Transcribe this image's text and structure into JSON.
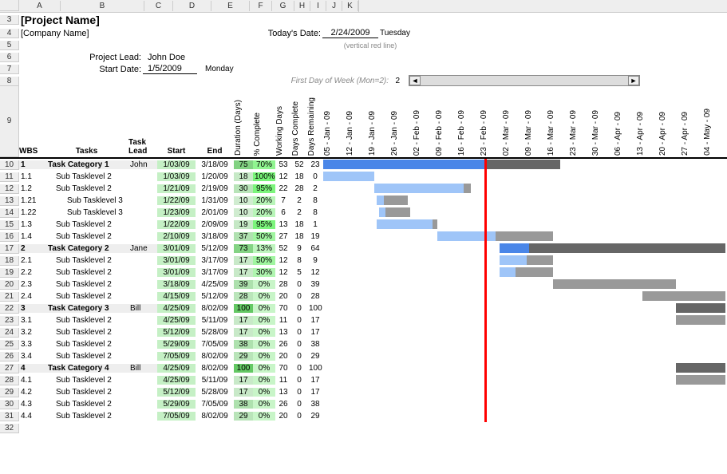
{
  "col_letters": [
    "A",
    "B",
    "C",
    "D",
    "E",
    "F",
    "G",
    "H",
    "I",
    "J",
    "K"
  ],
  "col_letter_widths": [
    52,
    105,
    36,
    48,
    48,
    28,
    28,
    20,
    20,
    20,
    20
  ],
  "header": {
    "project_name": "[Project Name]",
    "company_name": "[Company Name]",
    "todays_date_label": "Today's Date:",
    "todays_date": "2/24/2009",
    "todays_day": "Tuesday",
    "vertical_note": "(vertical red line)",
    "project_lead_label": "Project Lead:",
    "project_lead": "John Doe",
    "start_date_label": "Start Date:",
    "start_date": "1/5/2009",
    "start_day": "Monday",
    "first_day_label": "First Day of Week (Mon=2):",
    "first_day_value": "2"
  },
  "columns": {
    "wbs": "WBS",
    "tasks": "Tasks",
    "lead": "Task Lead",
    "start": "Start",
    "end": "End",
    "duration": "Duration (Days)",
    "pct": "% Complete",
    "wd": "Working Days",
    "dc": "Days Complete",
    "dr": "Days Remaining"
  },
  "timeline": [
    "05 - Jan - 09",
    "12 - Jan - 09",
    "19 - Jan - 09",
    "26 - Jan - 09",
    "02 - Feb - 09",
    "09 - Feb - 09",
    "16 - Feb - 09",
    "23 - Feb - 09",
    "02 - Mar - 09",
    "09 - Mar - 09",
    "16 - Mar - 09",
    "23 - Mar - 09",
    "30 - Mar - 09",
    "06 - Apr - 09",
    "13 - Apr - 09",
    "20 - Apr - 09",
    "27 - Apr - 09",
    "04 - May - 09"
  ],
  "today_index": 7.2,
  "row_start": 10,
  "rows": [
    {
      "wbs": "1",
      "task": "Task Category 1",
      "lead": "John",
      "start": "1/03/09",
      "end": "3/18/09",
      "dur": 75,
      "pct": "70%",
      "wd": 53,
      "dc": 52,
      "dr": 23,
      "cat": true,
      "bar": {
        "l": 0,
        "w": 7.2,
        "cls": "bar-blue-dark"
      },
      "bar2": {
        "l": 7.2,
        "w": 3.4,
        "cls": "bar-gray-dark"
      }
    },
    {
      "wbs": "1.1",
      "task": "Sub Tasklevel 2",
      "lead": "",
      "start": "1/03/09",
      "end": "1/20/09",
      "dur": 18,
      "pct": "100%",
      "wd": 12,
      "dc": 18,
      "dr": 0,
      "bar": {
        "l": 0,
        "w": 2.3,
        "cls": "bar-blue-light"
      }
    },
    {
      "wbs": "1.2",
      "task": "Sub Tasklevel 2",
      "lead": "",
      "start": "1/21/09",
      "end": "2/19/09",
      "dur": 30,
      "pct": "95%",
      "wd": 22,
      "dc": 28,
      "dr": 2,
      "bar": {
        "l": 2.3,
        "w": 4.0,
        "cls": "bar-blue-light"
      },
      "bar2": {
        "l": 6.3,
        "w": 0.3,
        "cls": "bar-gray-light"
      }
    },
    {
      "wbs": "1.21",
      "task": "Sub Tasklevel 3",
      "lead": "",
      "start": "1/22/09",
      "end": "1/31/09",
      "dur": 10,
      "pct": "20%",
      "wd": 7,
      "dc": 2,
      "dr": 8,
      "indent": 1,
      "bar": {
        "l": 2.4,
        "w": 0.3,
        "cls": "bar-blue-light"
      },
      "bar2": {
        "l": 2.7,
        "w": 1.1,
        "cls": "bar-gray-light"
      }
    },
    {
      "wbs": "1.22",
      "task": "Sub Tasklevel 3",
      "lead": "",
      "start": "1/23/09",
      "end": "2/01/09",
      "dur": 10,
      "pct": "20%",
      "wd": 6,
      "dc": 2,
      "dr": 8,
      "indent": 1,
      "bar": {
        "l": 2.5,
        "w": 0.3,
        "cls": "bar-blue-light"
      },
      "bar2": {
        "l": 2.8,
        "w": 1.1,
        "cls": "bar-gray-light"
      }
    },
    {
      "wbs": "1.3",
      "task": "Sub Tasklevel 2",
      "lead": "",
      "start": "1/22/09",
      "end": "2/09/09",
      "dur": 19,
      "pct": "95%",
      "wd": 13,
      "dc": 18,
      "dr": 1,
      "bar": {
        "l": 2.4,
        "w": 2.5,
        "cls": "bar-blue-light"
      },
      "bar2": {
        "l": 4.9,
        "w": 0.2,
        "cls": "bar-gray-light"
      }
    },
    {
      "wbs": "1.4",
      "task": "Sub Tasklevel 2",
      "lead": "",
      "start": "2/10/09",
      "end": "3/18/09",
      "dur": 37,
      "pct": "50%",
      "wd": 27,
      "dc": 18,
      "dr": 19,
      "bar": {
        "l": 5.1,
        "w": 2.6,
        "cls": "bar-blue-light"
      },
      "bar2": {
        "l": 7.7,
        "w": 2.6,
        "cls": "bar-gray-light"
      }
    },
    {
      "wbs": "2",
      "task": "Task Category 2",
      "lead": "Jane",
      "start": "3/01/09",
      "end": "5/12/09",
      "dur": 73,
      "pct": "13%",
      "wd": 52,
      "dc": 9,
      "dr": 64,
      "cat": true,
      "bar": {
        "l": 7.9,
        "w": 1.3,
        "cls": "bar-blue-dark"
      },
      "bar2": {
        "l": 9.2,
        "w": 8.8,
        "cls": "bar-gray-dark"
      }
    },
    {
      "wbs": "2.1",
      "task": "Sub Tasklevel 2",
      "lead": "",
      "start": "3/01/09",
      "end": "3/17/09",
      "dur": 17,
      "pct": "50%",
      "wd": 12,
      "dc": 8,
      "dr": 9,
      "bar": {
        "l": 7.9,
        "w": 1.2,
        "cls": "bar-blue-light"
      },
      "bar2": {
        "l": 9.1,
        "w": 1.2,
        "cls": "bar-gray-light"
      }
    },
    {
      "wbs": "2.2",
      "task": "Sub Tasklevel 2",
      "lead": "",
      "start": "3/01/09",
      "end": "3/17/09",
      "dur": 17,
      "pct": "30%",
      "wd": 12,
      "dc": 5,
      "dr": 12,
      "bar": {
        "l": 7.9,
        "w": 0.7,
        "cls": "bar-blue-light"
      },
      "bar2": {
        "l": 8.6,
        "w": 1.7,
        "cls": "bar-gray-light"
      }
    },
    {
      "wbs": "2.3",
      "task": "Sub Tasklevel 2",
      "lead": "",
      "start": "3/18/09",
      "end": "4/25/09",
      "dur": 39,
      "pct": "0%",
      "wd": 28,
      "dc": 0,
      "dr": 39,
      "bar2": {
        "l": 10.3,
        "w": 5.5,
        "cls": "bar-gray-light"
      }
    },
    {
      "wbs": "2.4",
      "task": "Sub Tasklevel 2",
      "lead": "",
      "start": "4/15/09",
      "end": "5/12/09",
      "dur": 28,
      "pct": "0%",
      "wd": 20,
      "dc": 0,
      "dr": 28,
      "bar2": {
        "l": 14.3,
        "w": 3.7,
        "cls": "bar-gray-light"
      }
    },
    {
      "wbs": "3",
      "task": "Task Category 3",
      "lead": "Bill",
      "start": "4/25/09",
      "end": "8/02/09",
      "dur": 100,
      "pct": "0%",
      "wd": 70,
      "dc": 0,
      "dr": 100,
      "cat": true,
      "bar2": {
        "l": 15.8,
        "w": 2.2,
        "cls": "bar-gray-dark"
      }
    },
    {
      "wbs": "3.1",
      "task": "Sub Tasklevel 2",
      "lead": "",
      "start": "4/25/09",
      "end": "5/11/09",
      "dur": 17,
      "pct": "0%",
      "wd": 11,
      "dc": 0,
      "dr": 17,
      "bar2": {
        "l": 15.8,
        "w": 2.2,
        "cls": "bar-gray-light"
      }
    },
    {
      "wbs": "3.2",
      "task": "Sub Tasklevel 2",
      "lead": "",
      "start": "5/12/09",
      "end": "5/28/09",
      "dur": 17,
      "pct": "0%",
      "wd": 13,
      "dc": 0,
      "dr": 17
    },
    {
      "wbs": "3.3",
      "task": "Sub Tasklevel 2",
      "lead": "",
      "start": "5/29/09",
      "end": "7/05/09",
      "dur": 38,
      "pct": "0%",
      "wd": 26,
      "dc": 0,
      "dr": 38
    },
    {
      "wbs": "3.4",
      "task": "Sub Tasklevel 2",
      "lead": "",
      "start": "7/05/09",
      "end": "8/02/09",
      "dur": 29,
      "pct": "0%",
      "wd": 20,
      "dc": 0,
      "dr": 29
    },
    {
      "wbs": "4",
      "task": "Task Category 4",
      "lead": "Bill",
      "start": "4/25/09",
      "end": "8/02/09",
      "dur": 100,
      "pct": "0%",
      "wd": 70,
      "dc": 0,
      "dr": 100,
      "cat": true,
      "bar2": {
        "l": 15.8,
        "w": 2.2,
        "cls": "bar-gray-dark"
      }
    },
    {
      "wbs": "4.1",
      "task": "Sub Tasklevel 2",
      "lead": "",
      "start": "4/25/09",
      "end": "5/11/09",
      "dur": 17,
      "pct": "0%",
      "wd": 11,
      "dc": 0,
      "dr": 17,
      "bar2": {
        "l": 15.8,
        "w": 2.2,
        "cls": "bar-gray-light"
      }
    },
    {
      "wbs": "4.2",
      "task": "Sub Tasklevel 2",
      "lead": "",
      "start": "5/12/09",
      "end": "5/28/09",
      "dur": 17,
      "pct": "0%",
      "wd": 13,
      "dc": 0,
      "dr": 17
    },
    {
      "wbs": "4.3",
      "task": "Sub Tasklevel 2",
      "lead": "",
      "start": "5/29/09",
      "end": "7/05/09",
      "dur": 38,
      "pct": "0%",
      "wd": 26,
      "dc": 0,
      "dr": 38
    },
    {
      "wbs": "4.4",
      "task": "Sub Tasklevel 2",
      "lead": "",
      "start": "7/05/09",
      "end": "8/02/09",
      "dur": 29,
      "pct": "0%",
      "wd": 20,
      "dc": 0,
      "dr": 29
    }
  ],
  "chart_data": {
    "type": "bar",
    "title": "Gantt Chart",
    "x": [
      "05-Jan-09",
      "12-Jan-09",
      "19-Jan-09",
      "26-Jan-09",
      "02-Feb-09",
      "09-Feb-09",
      "16-Feb-09",
      "23-Feb-09",
      "02-Mar-09",
      "09-Mar-09",
      "16-Mar-09",
      "23-Mar-09",
      "30-Mar-09",
      "06-Apr-09",
      "13-Apr-09",
      "20-Apr-09",
      "27-Apr-09",
      "04-May-09"
    ],
    "today": "2/24/2009",
    "series": [
      {
        "name": "Task Category 1",
        "start": "1/03/09",
        "end": "3/18/09",
        "complete": 0.7
      },
      {
        "name": "Sub 1.1",
        "start": "1/03/09",
        "end": "1/20/09",
        "complete": 1.0
      },
      {
        "name": "Sub 1.2",
        "start": "1/21/09",
        "end": "2/19/09",
        "complete": 0.95
      },
      {
        "name": "Sub 1.21",
        "start": "1/22/09",
        "end": "1/31/09",
        "complete": 0.2
      },
      {
        "name": "Sub 1.22",
        "start": "1/23/09",
        "end": "2/01/09",
        "complete": 0.2
      },
      {
        "name": "Sub 1.3",
        "start": "1/22/09",
        "end": "2/09/09",
        "complete": 0.95
      },
      {
        "name": "Sub 1.4",
        "start": "2/10/09",
        "end": "3/18/09",
        "complete": 0.5
      },
      {
        "name": "Task Category 2",
        "start": "3/01/09",
        "end": "5/12/09",
        "complete": 0.13
      },
      {
        "name": "Sub 2.1",
        "start": "3/01/09",
        "end": "3/17/09",
        "complete": 0.5
      },
      {
        "name": "Sub 2.2",
        "start": "3/01/09",
        "end": "3/17/09",
        "complete": 0.3
      },
      {
        "name": "Sub 2.3",
        "start": "3/18/09",
        "end": "4/25/09",
        "complete": 0.0
      },
      {
        "name": "Sub 2.4",
        "start": "4/15/09",
        "end": "5/12/09",
        "complete": 0.0
      },
      {
        "name": "Task Category 3",
        "start": "4/25/09",
        "end": "8/02/09",
        "complete": 0.0
      },
      {
        "name": "Sub 3.1",
        "start": "4/25/09",
        "end": "5/11/09",
        "complete": 0.0
      },
      {
        "name": "Sub 3.2",
        "start": "5/12/09",
        "end": "5/28/09",
        "complete": 0.0
      },
      {
        "name": "Sub 3.3",
        "start": "5/29/09",
        "end": "7/05/09",
        "complete": 0.0
      },
      {
        "name": "Sub 3.4",
        "start": "7/05/09",
        "end": "8/02/09",
        "complete": 0.0
      },
      {
        "name": "Task Category 4",
        "start": "4/25/09",
        "end": "8/02/09",
        "complete": 0.0
      },
      {
        "name": "Sub 4.1",
        "start": "4/25/09",
        "end": "5/11/09",
        "complete": 0.0
      },
      {
        "name": "Sub 4.2",
        "start": "5/12/09",
        "end": "5/28/09",
        "complete": 0.0
      },
      {
        "name": "Sub 4.3",
        "start": "5/29/09",
        "end": "7/05/09",
        "complete": 0.0
      },
      {
        "name": "Sub 4.4",
        "start": "7/05/09",
        "end": "8/02/09",
        "complete": 0.0
      }
    ]
  }
}
